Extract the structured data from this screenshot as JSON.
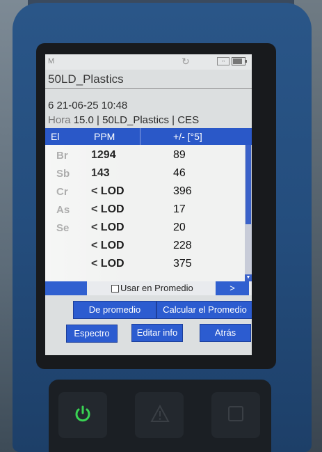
{
  "status": {
    "mode_letter": "M",
    "sync_icon": "sync-icon",
    "usb_icon": "usb-icon",
    "battery_level": 0.8
  },
  "title": "50LD_Plastics",
  "info": {
    "id_date": "6 21-06-25 10:48",
    "hora_label": "Hora",
    "hora_rest": "15.0 | 50LD_Plastics | CES"
  },
  "table": {
    "headers": [
      "El",
      "PPM",
      "+/- [°5]"
    ],
    "rows": [
      {
        "el": "Br",
        "ppm": "1294",
        "err": "89"
      },
      {
        "el": "Sb",
        "ppm": "143",
        "err": "46"
      },
      {
        "el": "Cr",
        "ppm": "< LOD",
        "err": "396"
      },
      {
        "el": "As",
        "ppm": "< LOD",
        "err": "17"
      },
      {
        "el": "Se",
        "ppm": "< LOD",
        "err": "20"
      },
      {
        "el": "",
        "ppm": "< LOD",
        "err": "228"
      },
      {
        "el": "",
        "ppm": "< LOD",
        "err": "375"
      }
    ]
  },
  "average": {
    "checkbox_label": "Usar en Promedio",
    "checked": false,
    "next_label": ">"
  },
  "buttons": {
    "delete_avg": "De promedio",
    "calc_avg": "Calcular el Promedio",
    "spectrum": "Espectro",
    "edit_info": "Editar info",
    "back": "Atrás"
  },
  "colors": {
    "accent": "#2c5cd0",
    "power_led": "#39d353"
  }
}
